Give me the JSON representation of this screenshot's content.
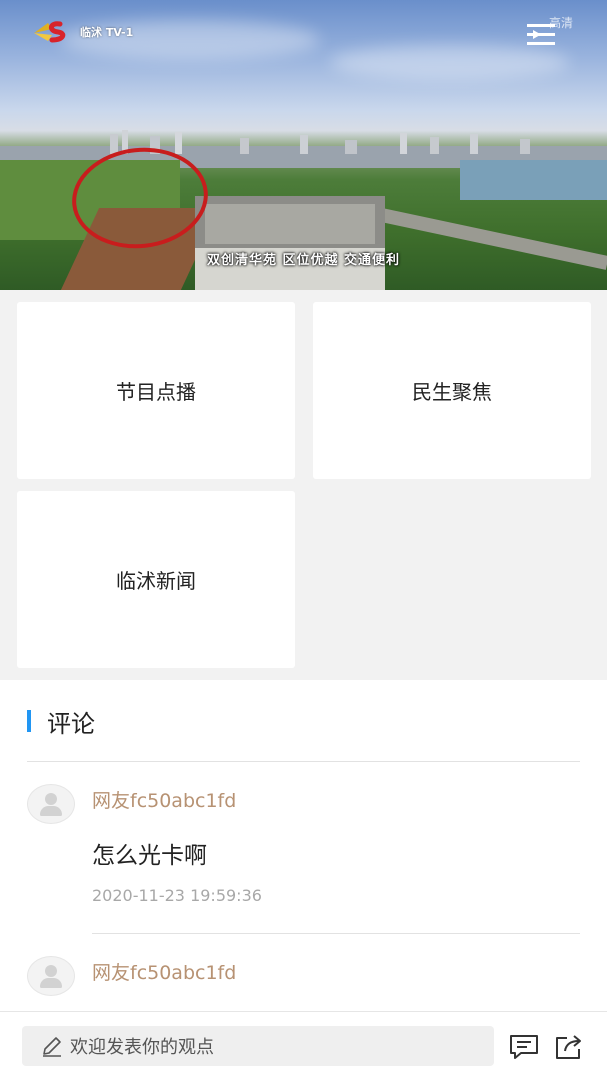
{
  "player": {
    "channel_logo_text": "临沭 TV-1",
    "quality_label": "高清",
    "caption": "双创清华苑 区位优越 交通便利"
  },
  "menu": {
    "items": [
      {
        "label": "节目点播"
      },
      {
        "label": "民生聚焦"
      },
      {
        "label": "临沭新闻"
      }
    ]
  },
  "comments": {
    "title": "评论",
    "items": [
      {
        "user": "网友fc50abc1fd",
        "text": "怎么光卡啊",
        "time": "2020-11-23 19:59:36"
      },
      {
        "user": "网友fc50abc1fd",
        "text": ""
      }
    ]
  },
  "bottom_bar": {
    "input_placeholder": "欢迎发表你的观点",
    "icons": [
      "comment-icon",
      "share-icon",
      "edit-icon"
    ]
  },
  "colors": {
    "accent": "#2196f3",
    "username": "#b79273",
    "highlight_circle": "#c81d1d"
  }
}
